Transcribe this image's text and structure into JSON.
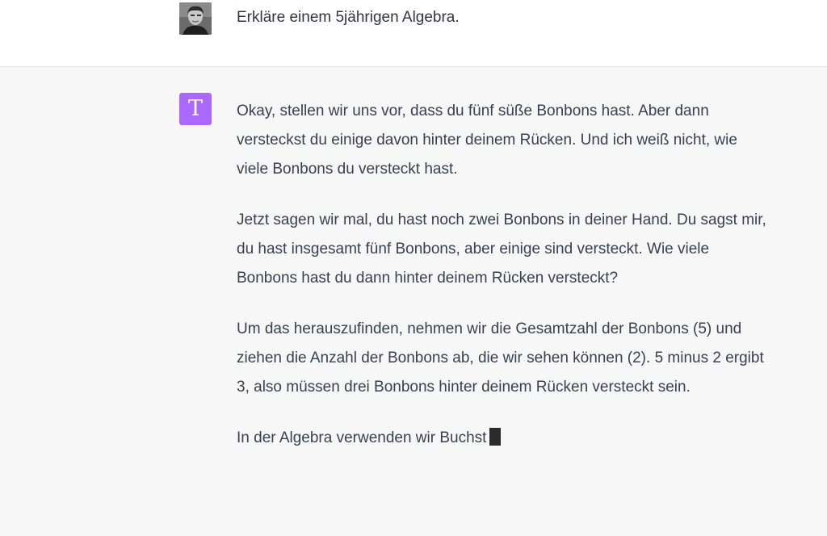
{
  "conversation": {
    "user_message": {
      "avatar": "user-photo-avatar",
      "text": "Erkläre einem 5jährigen Algebra."
    },
    "assistant_message": {
      "avatar_letter": "T",
      "avatar_color": "#ab68ff",
      "paragraphs": [
        "Okay, stellen wir uns vor, dass du fünf süße Bonbons hast. Aber dann versteckst du einige davon hinter deinem Rücken. Und ich weiß nicht, wie viele Bonbons du versteckt hast.",
        "Jetzt sagen wir mal, du hast noch zwei Bonbons in deiner Hand. Du sagst mir, du hast insgesamt fünf Bonbons, aber einige sind versteckt. Wie viele Bonbons hast du dann hinter deinem Rücken versteckt?",
        "Um das herauszufinden, nehmen wir die Gesamtzahl der Bonbons (5) und ziehen die Anzahl der Bonbons ab, die wir sehen können (2). 5 minus 2 ergibt 3, also müssen drei Bonbons hinter deinem Rücken versteckt sein.",
        "In der Algebra verwenden wir Buchst"
      ],
      "streaming": true
    }
  },
  "colors": {
    "user_row_bg": "#ffffff",
    "assistant_row_bg": "#f7f7f8",
    "text": "#374151"
  }
}
